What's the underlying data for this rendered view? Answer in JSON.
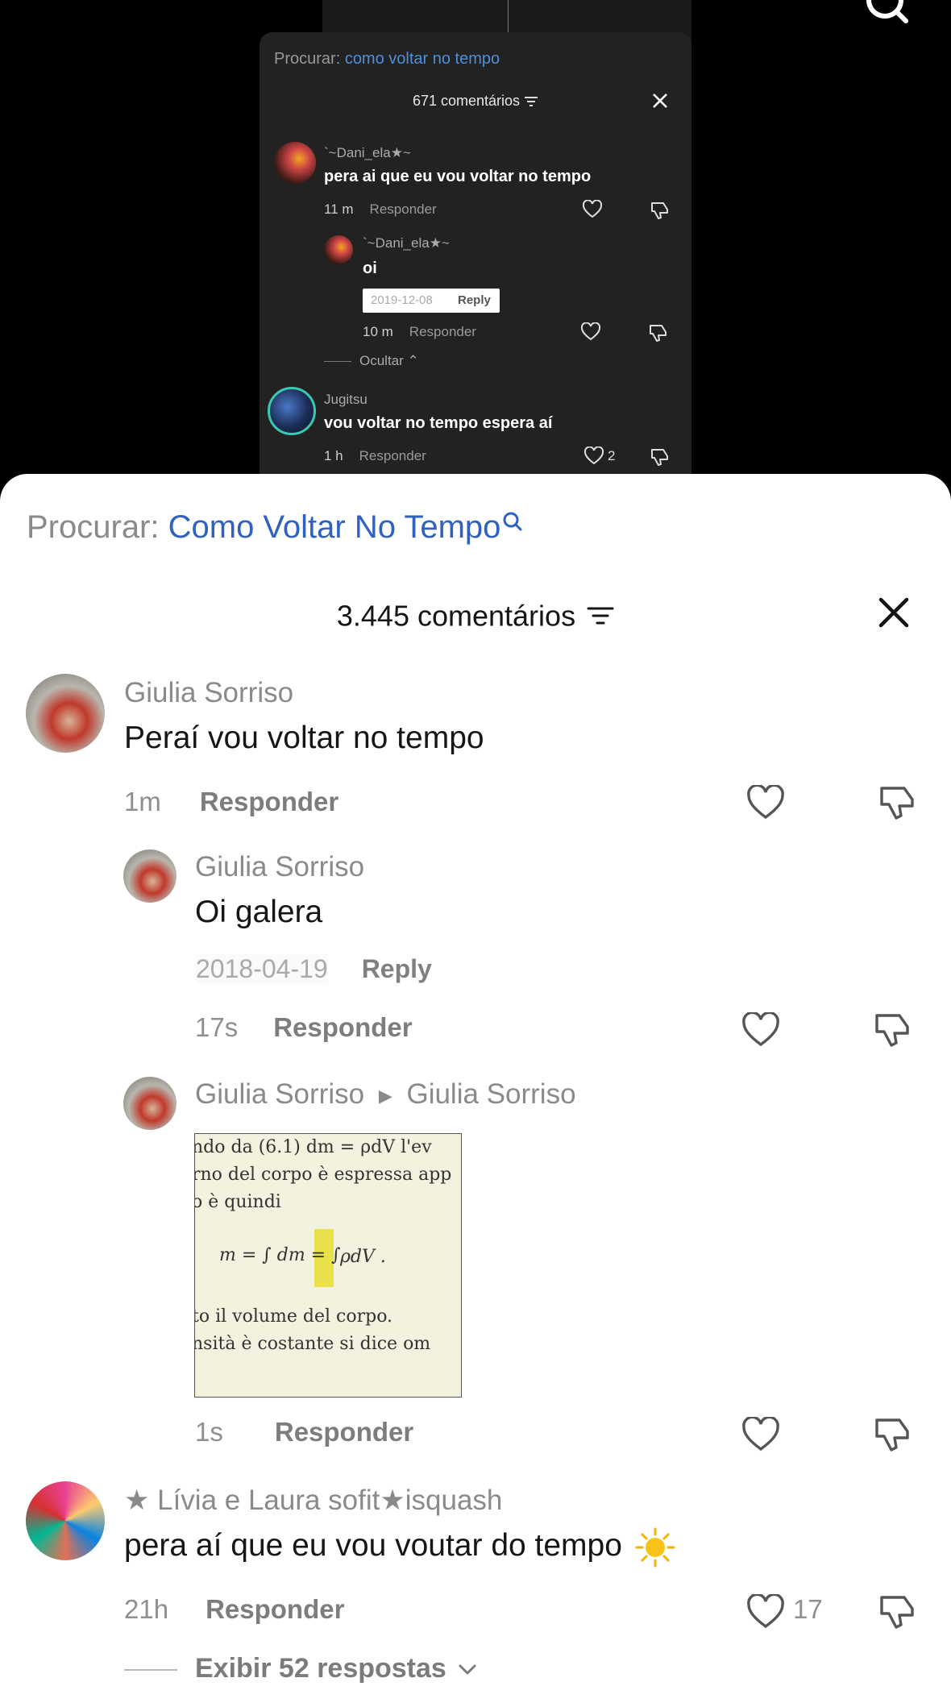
{
  "top_icon": "search-icon",
  "mini": {
    "search_label": "Procurar: ",
    "search_query": "como voltar no tempo",
    "comment_count": "671 comentários",
    "comments": [
      {
        "user": "`~Dani_ela★~",
        "text": "pera ai que eu vou voltar no tempo",
        "time": "11 m",
        "reply": "Responder"
      },
      {
        "user": "`~Dani_ela★~",
        "text": "oi",
        "date": "2019-12-08",
        "date_reply": "Reply",
        "time": "10 m",
        "reply": "Responder"
      },
      {
        "user": "Jugitsu",
        "text": "vou voltar no tempo espera aí",
        "time": "1 h",
        "reply": "Responder",
        "likes": "2"
      }
    ],
    "hide_label": "Ocultar"
  },
  "main": {
    "search_label": "Procurar: ",
    "search_query": "Como Voltar No Tempo",
    "comment_count": "3.445 comentários",
    "comments": [
      {
        "user": "Giulia Sorriso",
        "text": "Peraí vou voltar no tempo",
        "time": "1m",
        "reply": "Responder"
      },
      {
        "user": "Giulia Sorriso",
        "text": "Oi galera",
        "date": "2018-04-19",
        "date_reply": "Reply",
        "time": "17s",
        "reply": "Responder"
      },
      {
        "user": "Giulia Sorriso",
        "reply_to": "Giulia Sorriso",
        "time": "1s",
        "reply": "Responder",
        "image_text": {
          "line1": "ndo da (6.1)  dm = ρdV l'ev",
          "line2": "rno del corpo è espressa app",
          "line3": "o è quindi",
          "formula": "m = ∫ dm = ∫",
          "formula_tail": "ρdV .",
          "line4": "to il volume del corpo.",
          "line5": "nsità è costante si dice om"
        }
      },
      {
        "user": "★ Lívia e Laura sofit★isquash",
        "text": "pera aí que eu vou voutar do tempo",
        "time": "21h",
        "reply": "Responder",
        "likes": "17"
      }
    ],
    "show_more": "Exibir 52 respostas"
  },
  "colors": {
    "link": "#2f62c0",
    "muted": "#8a8a8a",
    "sheet": "#ffffff",
    "dark": "#222223"
  }
}
